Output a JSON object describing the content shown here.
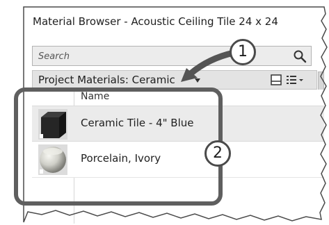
{
  "window": {
    "title": "Material Browser - Acoustic Ceiling Tile 24 x 24"
  },
  "search": {
    "placeholder": "Search",
    "icon": "search-icon"
  },
  "project_bar": {
    "label": "Project Materials: Ceramic",
    "icons": [
      "chevron-down-icon",
      "panel-layout-icon",
      "list-view-icon"
    ]
  },
  "table": {
    "header": "Name",
    "rows": [
      {
        "label": "Ceramic Tile - 4\" Blue",
        "swatch": "dark-cube-swatch"
      },
      {
        "label": "Porcelain, Ivory",
        "swatch": "ivory-sphere-swatch"
      }
    ]
  },
  "callouts": {
    "badge1": "1",
    "badge2": "2"
  },
  "colors": {
    "callout_gray": "#5f5f5f",
    "row_highlight": "#ebebeb",
    "bar_gray": "#e3e3e3"
  }
}
